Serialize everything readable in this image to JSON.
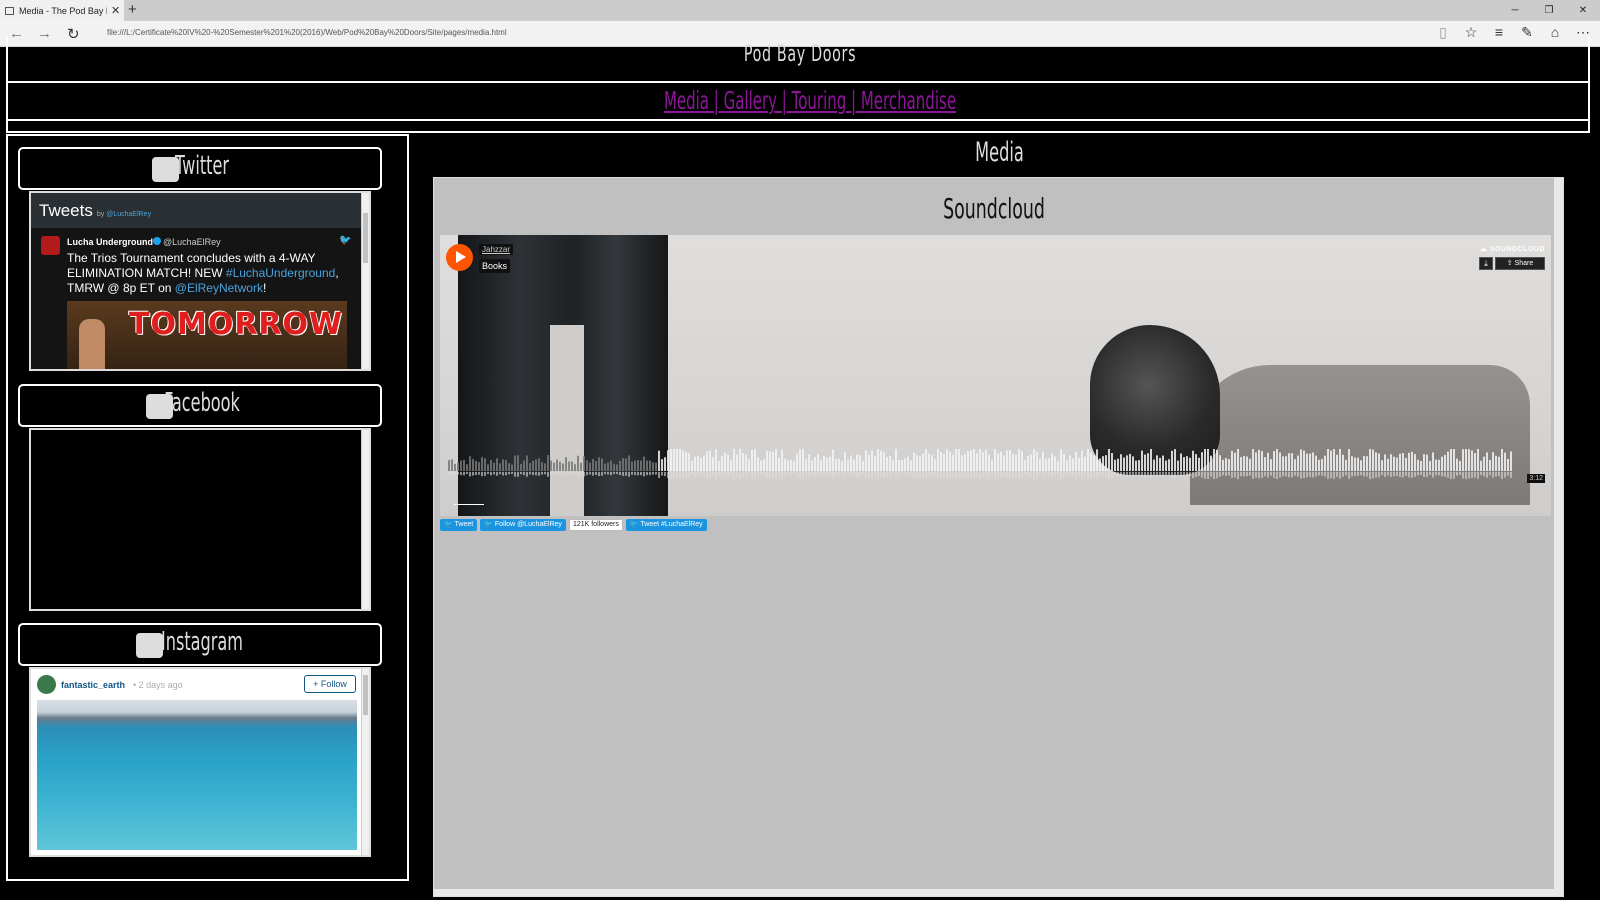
{
  "browser": {
    "tab_title": "Media - The Pod Bay Do",
    "url": "file:///L:/Certificate%20IV%20-%20Semester%201%20(2016)/Web/Pod%20Bay%20Doors/Site/pages/media.html"
  },
  "site": {
    "title": "Pod Bay Doors",
    "nav_text": "Media | Gallery | Touring | Merchandise",
    "nav_color": "#8e1599"
  },
  "sidebar": {
    "twitter": {
      "heading": "Twitter",
      "widget": {
        "header": "Tweets",
        "by": "by",
        "by_handle": "@LuchaElRey",
        "tweet": {
          "name": "Lucha Underground",
          "handle": "@LuchaElRey",
          "text_1": "The Trios Tournament concludes with a 4-WAY ELIMINATION MATCH! NEW ",
          "hashtag": "#LuchaUnderground",
          "text_2": ", TMRW @ 8p ET on ",
          "mention": "@ElReyNetwork",
          "text_3": "!",
          "media_text": "TOMORROW"
        }
      }
    },
    "facebook": {
      "heading": "Facebook"
    },
    "instagram": {
      "heading": "Instagram",
      "widget": {
        "user": "fantastic_earth",
        "time": "• 2 days ago",
        "follow": "+ Follow"
      }
    }
  },
  "main": {
    "title": "Media",
    "section_title": "Soundcloud",
    "soundcloud": {
      "artist": "Jahzzar",
      "track": "Books",
      "logo": "SOUNDCLOUD",
      "share": "Share",
      "duration": "3:12",
      "accent": "#ff5500"
    },
    "twitter_buttons": {
      "tweet": "Tweet",
      "follow": "Follow @LuchaElRey",
      "followers": "121K followers",
      "tweet_hashtag": "Tweet #LuchaElRey"
    }
  }
}
